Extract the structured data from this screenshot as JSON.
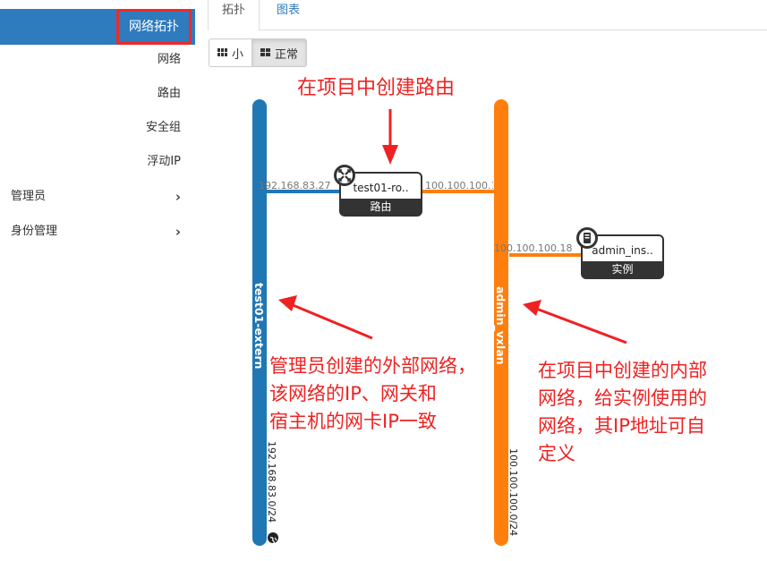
{
  "sidebar": {
    "active_item": "网络拓扑",
    "items": [
      "网络",
      "路由",
      "安全组",
      "浮动IP"
    ],
    "groups": [
      {
        "label": "管理员",
        "chevron": "›"
      },
      {
        "label": "身份管理",
        "chevron": "›"
      }
    ]
  },
  "tabs": [
    {
      "label": "拓扑",
      "active": true
    },
    {
      "label": "图表",
      "active": false
    }
  ],
  "size_toggle": {
    "small_label": "小",
    "normal_label": "正常",
    "selected": "正常"
  },
  "topology": {
    "networks": [
      {
        "name": "test01-extern",
        "cidr": "192.168.83.0/24",
        "color": "#1f77b4",
        "external": true
      },
      {
        "name": "admin_vxlan",
        "cidr": "100.100.100.0/24",
        "color": "#ff7f0e",
        "external": false
      }
    ],
    "router": {
      "name": "test01-ro..",
      "type": "路由",
      "ip_left": "192.168.83.27",
      "ip_right": "100.100.100.1"
    },
    "instance": {
      "name": "admin_ins..",
      "type": "实例",
      "ip": "100.100.100.18"
    }
  },
  "annotations": {
    "router_note": "在项目中创建路由",
    "external_note": [
      "管理员创建的外部网络，",
      "该网络的IP、网关和",
      "宿主机的网卡IP一致"
    ],
    "internal_note": [
      "在项目中创建的内部",
      "网络，给实例使用的",
      "网络，其IP地址可自",
      "定义"
    ],
    "color": "#ee2222"
  }
}
